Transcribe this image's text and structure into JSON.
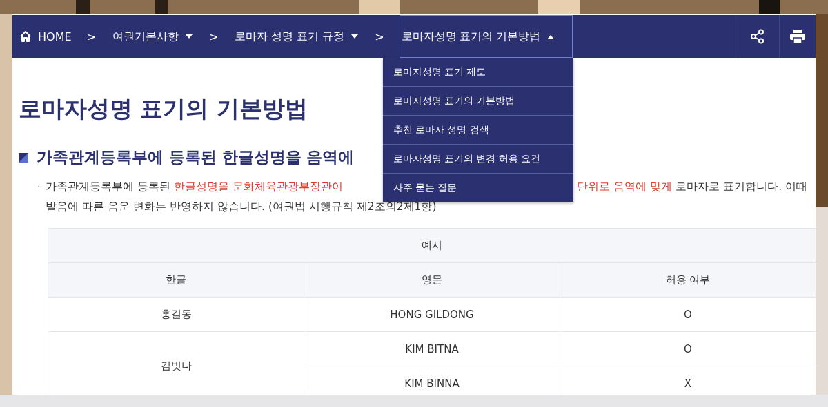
{
  "nav": {
    "home": "HOME",
    "separator": ">",
    "crumbs": [
      {
        "label": "여권기본사항",
        "expanded": false
      },
      {
        "label": "로마자 성명 표기 규정",
        "expanded": false
      },
      {
        "label": "로마자성명 표기의 기본방법",
        "expanded": true
      }
    ]
  },
  "dropdown": {
    "items": [
      "로마자성명 표기 제도",
      "로마자성명 표기의 기본방법",
      "추천 로마자 성명 검색",
      "로마자성명 표기의 변경 허용 요건",
      "자주 묻는 질문"
    ]
  },
  "page_title": "로마자성명 표기의 기본방법",
  "section_heading": "가족관계등록부에 등록된 한글성명을 음역에",
  "paragraph": {
    "bullet": "·",
    "lines": [
      [
        {
          "segments": [
            {
              "text": "가족관계등록부에 등록된 ",
              "emphasis": false
            },
            {
              "text": "한글성명을 문화체육관광부장관이",
              "emphasis": true
            }
          ]
        },
        {
          "segments": [
            {
              "text": "단위로 음역에 맞게",
              "emphasis": true
            },
            {
              "text": " 로마자로 표기합니다. 이때",
              "emphasis": false
            }
          ]
        }
      ],
      [
        {
          "segments": [
            {
              "text": "발음에 따른 음운 변화는 반영하지 않습니다. (여권법 시행규칙 제2조의2제1항)",
              "emphasis": false
            }
          ]
        }
      ]
    ]
  },
  "table": {
    "caption": "예시",
    "columns": [
      "한글",
      "영문",
      "허용 여부"
    ],
    "rows": [
      {
        "hangul": "홍길동",
        "romanizations": [
          {
            "english": "HONG GILDONG",
            "allowed": "O"
          }
        ]
      },
      {
        "hangul": "김빗나",
        "romanizations": [
          {
            "english": "KIM BITNA",
            "allowed": "O"
          },
          {
            "english": "KIM BINNA",
            "allowed": "X"
          }
        ]
      }
    ]
  }
}
